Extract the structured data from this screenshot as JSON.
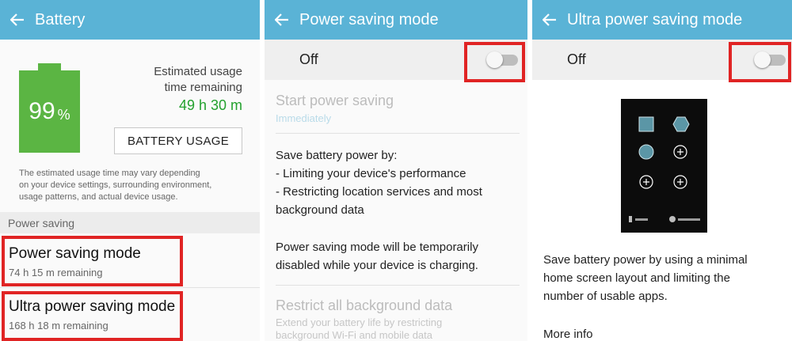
{
  "colors": {
    "appbar": "#5ab3d6",
    "battery": "#5bb543",
    "estimate": "#23a12e",
    "highlight": "#e02424"
  },
  "battery_screen": {
    "title": "Battery",
    "level_number": "99",
    "level_unit": "%",
    "estimate_label_line1": "Estimated usage",
    "estimate_label_line2": "time remaining",
    "estimate_value": "49 h 30 m",
    "usage_button": "BATTERY USAGE",
    "disclaimer_lines": [
      "The estimated usage time may vary depending",
      "on your device settings, surrounding environment,",
      "usage patterns, and actual device usage."
    ],
    "section_header": "Power saving",
    "items": [
      {
        "title": "Power saving mode",
        "subtitle": "74 h 15 m remaining"
      },
      {
        "title": "Ultra power saving mode",
        "subtitle": "168 h 18 m remaining"
      }
    ]
  },
  "power_saving_screen": {
    "title": "Power saving mode",
    "toggle_label": "Off",
    "toggle_on": false,
    "start_title": "Start power saving",
    "start_value": "Immediately",
    "save_lines": [
      "Save battery power by:",
      "- Limiting your device's performance",
      "- Restricting location services and most",
      "background data"
    ],
    "charging_lines": [
      "Power saving mode will be temporarily",
      "disabled while your device is charging."
    ],
    "restrict_title": "Restrict all background data",
    "restrict_lines": [
      "Extend your battery life by restricting",
      "background Wi-Fi and mobile data"
    ]
  },
  "ultra_screen": {
    "title": "Ultra power saving mode",
    "toggle_label": "Off",
    "toggle_on": false,
    "description_lines": [
      "Save battery power by using a minimal",
      "home screen layout and limiting the",
      "number of usable apps."
    ],
    "more_info": "More info"
  }
}
